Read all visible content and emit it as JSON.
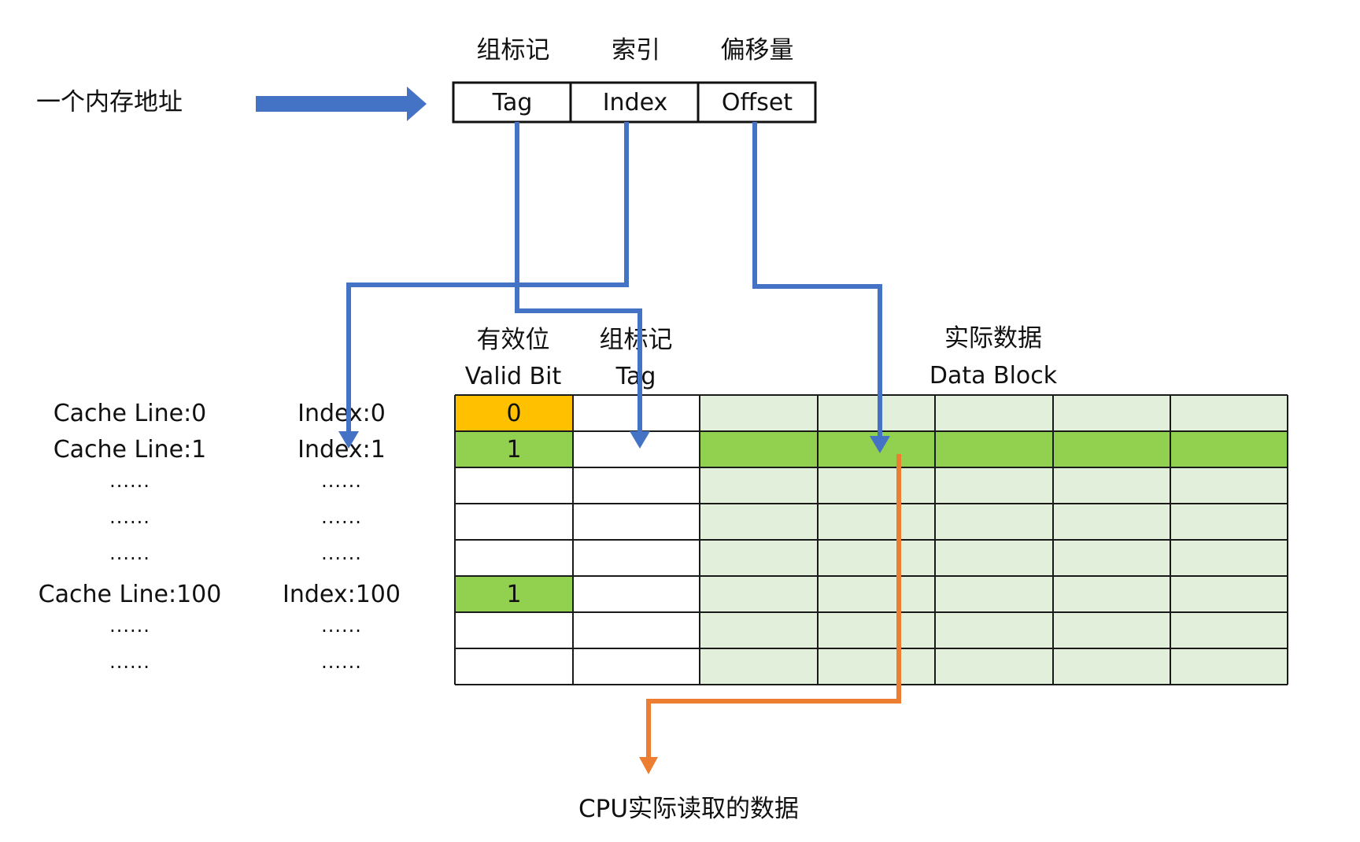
{
  "address": {
    "caption": "一个内存地址",
    "headers": [
      "组标记",
      "索引",
      "偏移量"
    ],
    "fields": [
      "Tag",
      "Index",
      "Offset"
    ]
  },
  "table_headers": {
    "valid_cn": "有效位",
    "valid_en": "Valid Bit",
    "tag_cn": "组标记",
    "tag_en": "Tag",
    "data_cn": "实际数据",
    "data_en": "Data Block"
  },
  "rows": [
    {
      "line": "Cache Line:0",
      "index": "Index:0",
      "valid": "0",
      "state": "invalid"
    },
    {
      "line": "Cache Line:1",
      "index": "Index:1",
      "valid": "1",
      "state": "active"
    },
    {
      "line": "......",
      "index": "......",
      "valid": "",
      "state": "empty"
    },
    {
      "line": "......",
      "index": "......",
      "valid": "",
      "state": "empty"
    },
    {
      "line": "......",
      "index": "......",
      "valid": "",
      "state": "empty"
    },
    {
      "line": "Cache Line:100",
      "index": "Index:100",
      "valid": "1",
      "state": "valid"
    },
    {
      "line": "......",
      "index": "......",
      "valid": "",
      "state": "empty"
    },
    {
      "line": "......",
      "index": "......",
      "valid": "",
      "state": "empty"
    }
  ],
  "output_caption": "CPU实际读取的数据",
  "colors": {
    "blue_arrow": "#4472C4",
    "orange_arrow": "#ED7D31",
    "valid_green": "#92D050",
    "invalid_orange": "#FFC000",
    "data_light_green": "#E2EFDA"
  }
}
